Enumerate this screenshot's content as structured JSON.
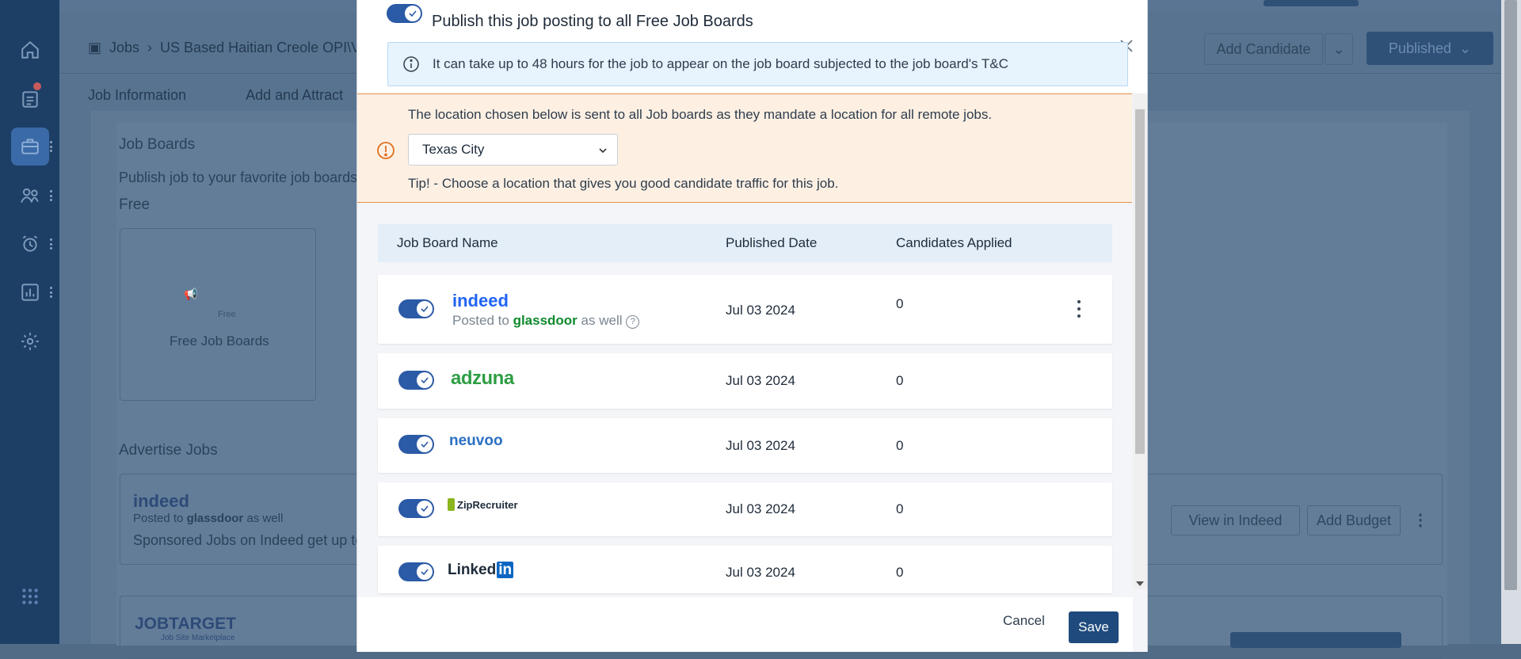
{
  "background": {
    "breadcrumb": {
      "root": "Jobs",
      "job": "US Based Haitian Creole OPI\\V"
    },
    "tabs": [
      "Job Information",
      "Add and Attract"
    ],
    "header_buttons": {
      "add_candidate": "Add Candidate",
      "status": "Published"
    },
    "job_boards": {
      "title": "Job Boards",
      "subtitle": "Publish job to your favorite job boards",
      "free_label": "Free",
      "free_card": "Free Job Boards",
      "free_badge": "Free"
    },
    "advertise": {
      "title": "Advertise Jobs",
      "indeed_logo": "indeed",
      "posted_to": "Posted to",
      "glassdoor": "glassdoor",
      "as_well": "as well",
      "sponsored_text": "Sponsored Jobs on Indeed get up to",
      "view_button": "View in Indeed",
      "budget_button": "Add Budget",
      "jobtarget_logo": "JOBTARGET",
      "jobtarget_sub": "Job Site Marketplace"
    }
  },
  "modal": {
    "publish_title": "Publish this job posting to all Free Job Boards",
    "info_text": "It can take up to 48 hours for the job to appear on the job board subjected to the job board's T&C",
    "location_notice": "The location chosen below is sent to all Job boards as they mandate a location for all remote jobs.",
    "location_value": "Texas City",
    "tip": "Tip! - Choose a location that gives you good candidate traffic for this job.",
    "table_headers": {
      "name": "Job Board Name",
      "date": "Published Date",
      "applied": "Candidates Applied"
    },
    "rows": [
      {
        "logo": "indeed",
        "posted_to": "Posted to",
        "glassdoor": "glassdoor",
        "as_well": "as well",
        "date": "Jul 03 2024",
        "applied": "0"
      },
      {
        "logo": "adzuna",
        "date": "Jul 03 2024",
        "applied": "0"
      },
      {
        "logo": "neuvoo",
        "date": "Jul 03 2024",
        "applied": "0"
      },
      {
        "logo": "ZipRecruiter",
        "date": "Jul 03 2024",
        "applied": "0"
      },
      {
        "logo": "Linked",
        "logo_in": "in",
        "date": "Jul 03 2024",
        "applied": "0"
      }
    ],
    "cancel": "Cancel",
    "save": "Save"
  },
  "colors": {
    "primary": "#2b5aa6",
    "warning": "#e7904a",
    "info_bg": "#e7f3fd",
    "glassdoor": "#0f8a2e",
    "adzuna": "#2e9e44",
    "indeed": "#2164f3"
  }
}
